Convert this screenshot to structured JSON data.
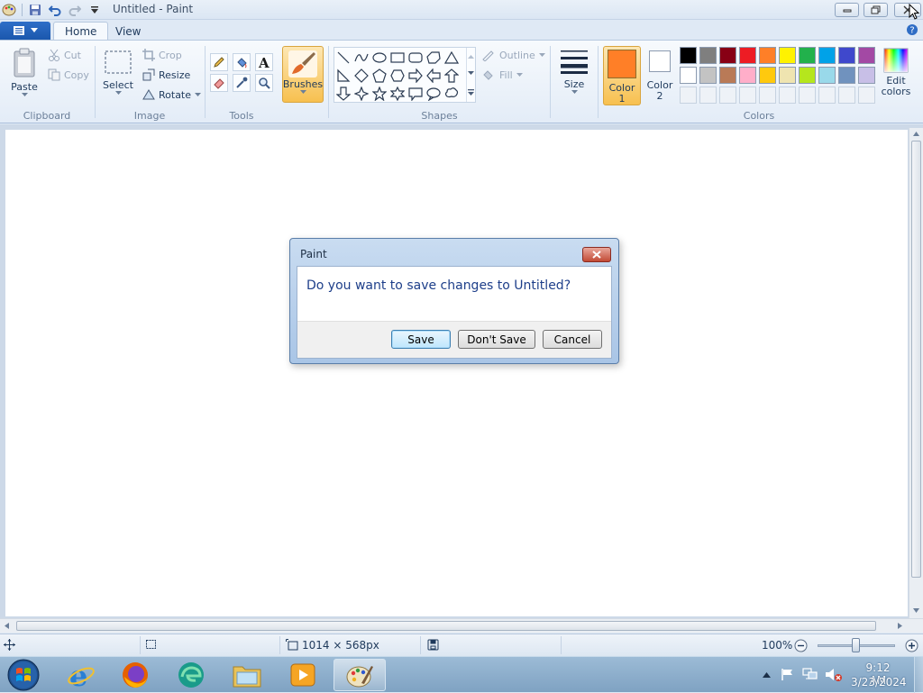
{
  "window": {
    "title": "Untitled - Paint"
  },
  "tabs": [
    {
      "label": "Home",
      "active": true
    },
    {
      "label": "View",
      "active": false
    }
  ],
  "ribbon": {
    "clipboard": {
      "group": "Clipboard",
      "paste": "Paste",
      "cut": "Cut",
      "copy": "Copy"
    },
    "image": {
      "group": "Image",
      "select": "Select",
      "crop": "Crop",
      "resize": "Resize",
      "rotate": "Rotate"
    },
    "tools": {
      "group": "Tools"
    },
    "brushes": {
      "label": "Brushes"
    },
    "shapes": {
      "group": "Shapes",
      "outline": "Outline",
      "fill": "Fill"
    },
    "size": {
      "label": "Size"
    },
    "colors": {
      "group": "Colors",
      "color1_label": "Color",
      "color1_num": "1",
      "color1_value": "#ff7f27",
      "color2_label": "Color",
      "color2_num": "2",
      "color2_value": "#ffffff",
      "edit_label": "Edit",
      "edit_label2": "colors",
      "palette_row1": [
        "#000000",
        "#7f7f7f",
        "#880015",
        "#ed1c24",
        "#ff7f27",
        "#fff200",
        "#22b14c",
        "#00a2e8",
        "#3f48cc",
        "#a349a4"
      ],
      "palette_row2": [
        "#ffffff",
        "#c3c3c3",
        "#b97a57",
        "#ffaec9",
        "#ffc90e",
        "#efe4b0",
        "#b5e61d",
        "#99d9ea",
        "#7092be",
        "#c8bfe7"
      ]
    }
  },
  "status": {
    "dimensions": "1014 × 568px",
    "zoom": "100%"
  },
  "dialog": {
    "title": "Paint",
    "message": "Do you want to save changes to Untitled?",
    "save": "Save",
    "dont_save": "Don't Save",
    "cancel": "Cancel"
  },
  "taskbar": {
    "time": "9:12 AM",
    "date": "3/23/2024",
    "apps": [
      "internet-explorer-icon",
      "firefox-icon",
      "edge-icon",
      "file-explorer-icon",
      "media-player-icon",
      "paint-icon"
    ]
  }
}
